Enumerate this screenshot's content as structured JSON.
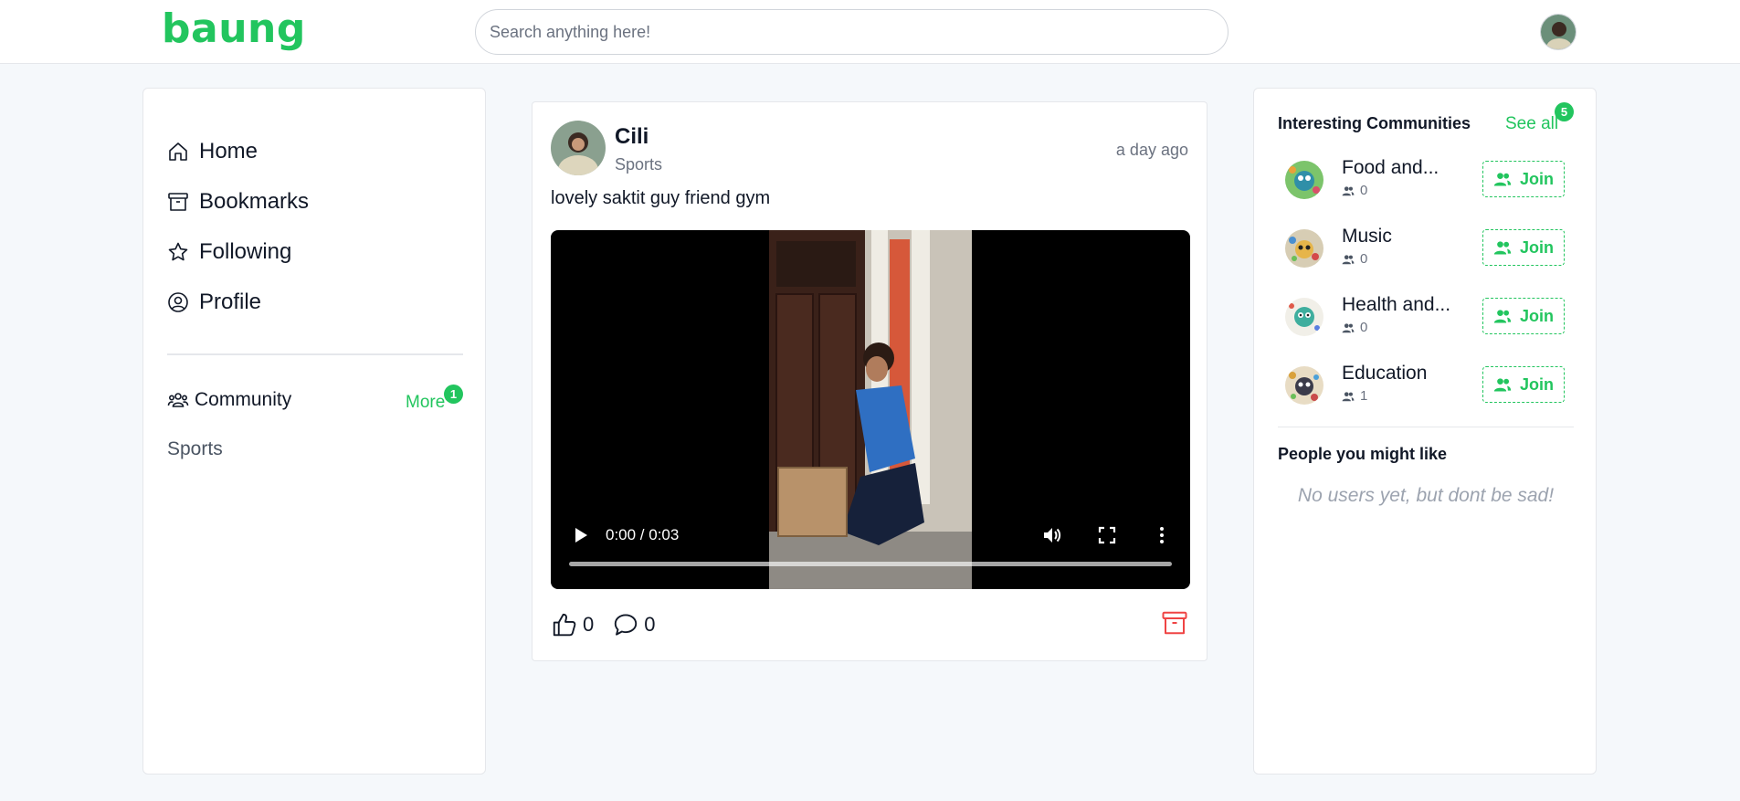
{
  "header": {
    "logo": "baung",
    "search_placeholder": "Search anything here!"
  },
  "sidebar": {
    "nav": [
      {
        "label": "Home",
        "icon": "home-icon"
      },
      {
        "label": "Bookmarks",
        "icon": "archive-icon"
      },
      {
        "label": "Following",
        "icon": "star-icon"
      },
      {
        "label": "Profile",
        "icon": "user-circle-icon"
      }
    ],
    "community_title": "Community",
    "more_label": "More",
    "more_badge": "1",
    "communities": [
      "Sports"
    ]
  },
  "post": {
    "author": "Cili",
    "community": "Sports",
    "time": "a day ago",
    "text": "lovely saktit guy friend gym",
    "video": {
      "time_display": "0:00 / 0:03"
    },
    "likes": "0",
    "comments": "0"
  },
  "right": {
    "title": "Interesting Communities",
    "see_all": "See all",
    "see_all_badge": "5",
    "communities": [
      {
        "name": "Food and...",
        "members": "0",
        "join": "Join"
      },
      {
        "name": "Music",
        "members": "0",
        "join": "Join"
      },
      {
        "name": "Health and...",
        "members": "0",
        "join": "Join"
      },
      {
        "name": "Education",
        "members": "1",
        "join": "Join"
      }
    ],
    "people_title": "People you might like",
    "people_empty": "No users yet, but dont be sad!"
  },
  "colors": {
    "accent": "#22c55e",
    "danger": "#ef4444",
    "background": "#f5f8fb"
  }
}
